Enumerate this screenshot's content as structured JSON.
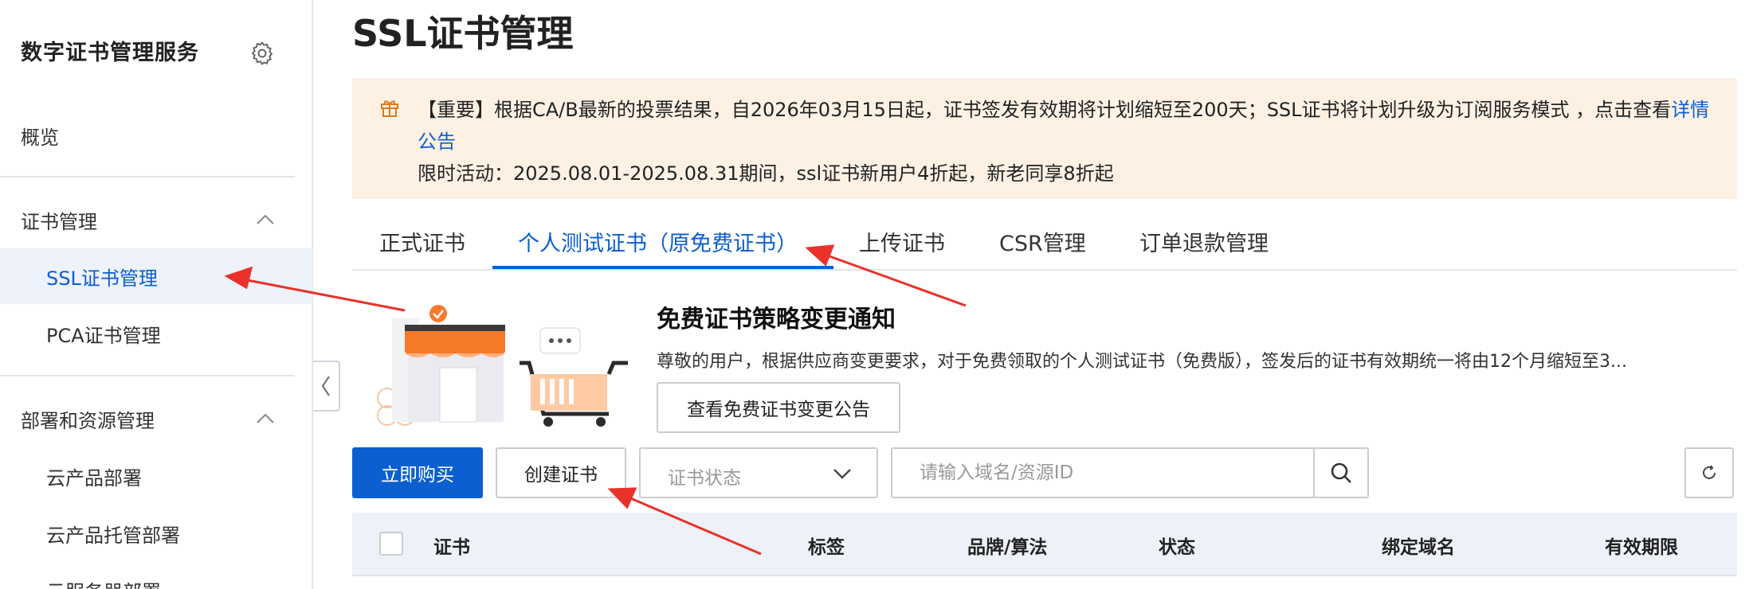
{
  "sidebar": {
    "title": "数字证书管理服务",
    "items": [
      {
        "label": "概览"
      },
      {
        "label": "证书管理"
      },
      {
        "label": "SSL证书管理"
      },
      {
        "label": "PCA证书管理"
      },
      {
        "label": "部署和资源管理"
      },
      {
        "label": "云产品部署"
      },
      {
        "label": "云产品托管部署"
      },
      {
        "label": "云服务器部署"
      }
    ]
  },
  "main": {
    "title": "SSL证书管理",
    "notice": {
      "text": "【重要】根据CA/B最新的投票结果，自2026年03月15日起，证书签发有效期将计划缩短至200天；SSL证书将计划升级为订阅服务模式 ，点击查看",
      "link": "详情公告",
      "activity": "限时活动：2025.08.01-2025.08.31期间，ssl证书新用户4折起，新老同享8折起"
    },
    "tabs": [
      {
        "label": "正式证书"
      },
      {
        "label": "个人测试证书（原免费证书）"
      },
      {
        "label": "上传证书"
      },
      {
        "label": "CSR管理"
      },
      {
        "label": "订单退款管理"
      }
    ],
    "promo": {
      "title": "免费证书策略变更通知",
      "desc": "尊敬的用户，根据供应商变更要求，对于免费领取的个人测试证书（免费版），签发后的证书有效期统一将由12个月缩短至3...",
      "button": "查看免费证书变更公告"
    },
    "toolbar": {
      "buy": "立即购买",
      "create": "创建证书",
      "status_placeholder": "证书状态",
      "search_placeholder": "请输入域名/资源ID"
    },
    "table": {
      "columns": [
        "证书",
        "标签",
        "品牌/算法",
        "状态",
        "绑定域名",
        "有效期限"
      ]
    }
  },
  "colors": {
    "accent": "#0b5fd0",
    "notice_bg": "#fdf1e4",
    "annotation": "#e8322a"
  },
  "icons": [
    "gear-icon",
    "chevron-up-icon",
    "chevron-left-icon",
    "gift-icon",
    "chevron-down-icon",
    "search-icon",
    "refresh-icon"
  ]
}
